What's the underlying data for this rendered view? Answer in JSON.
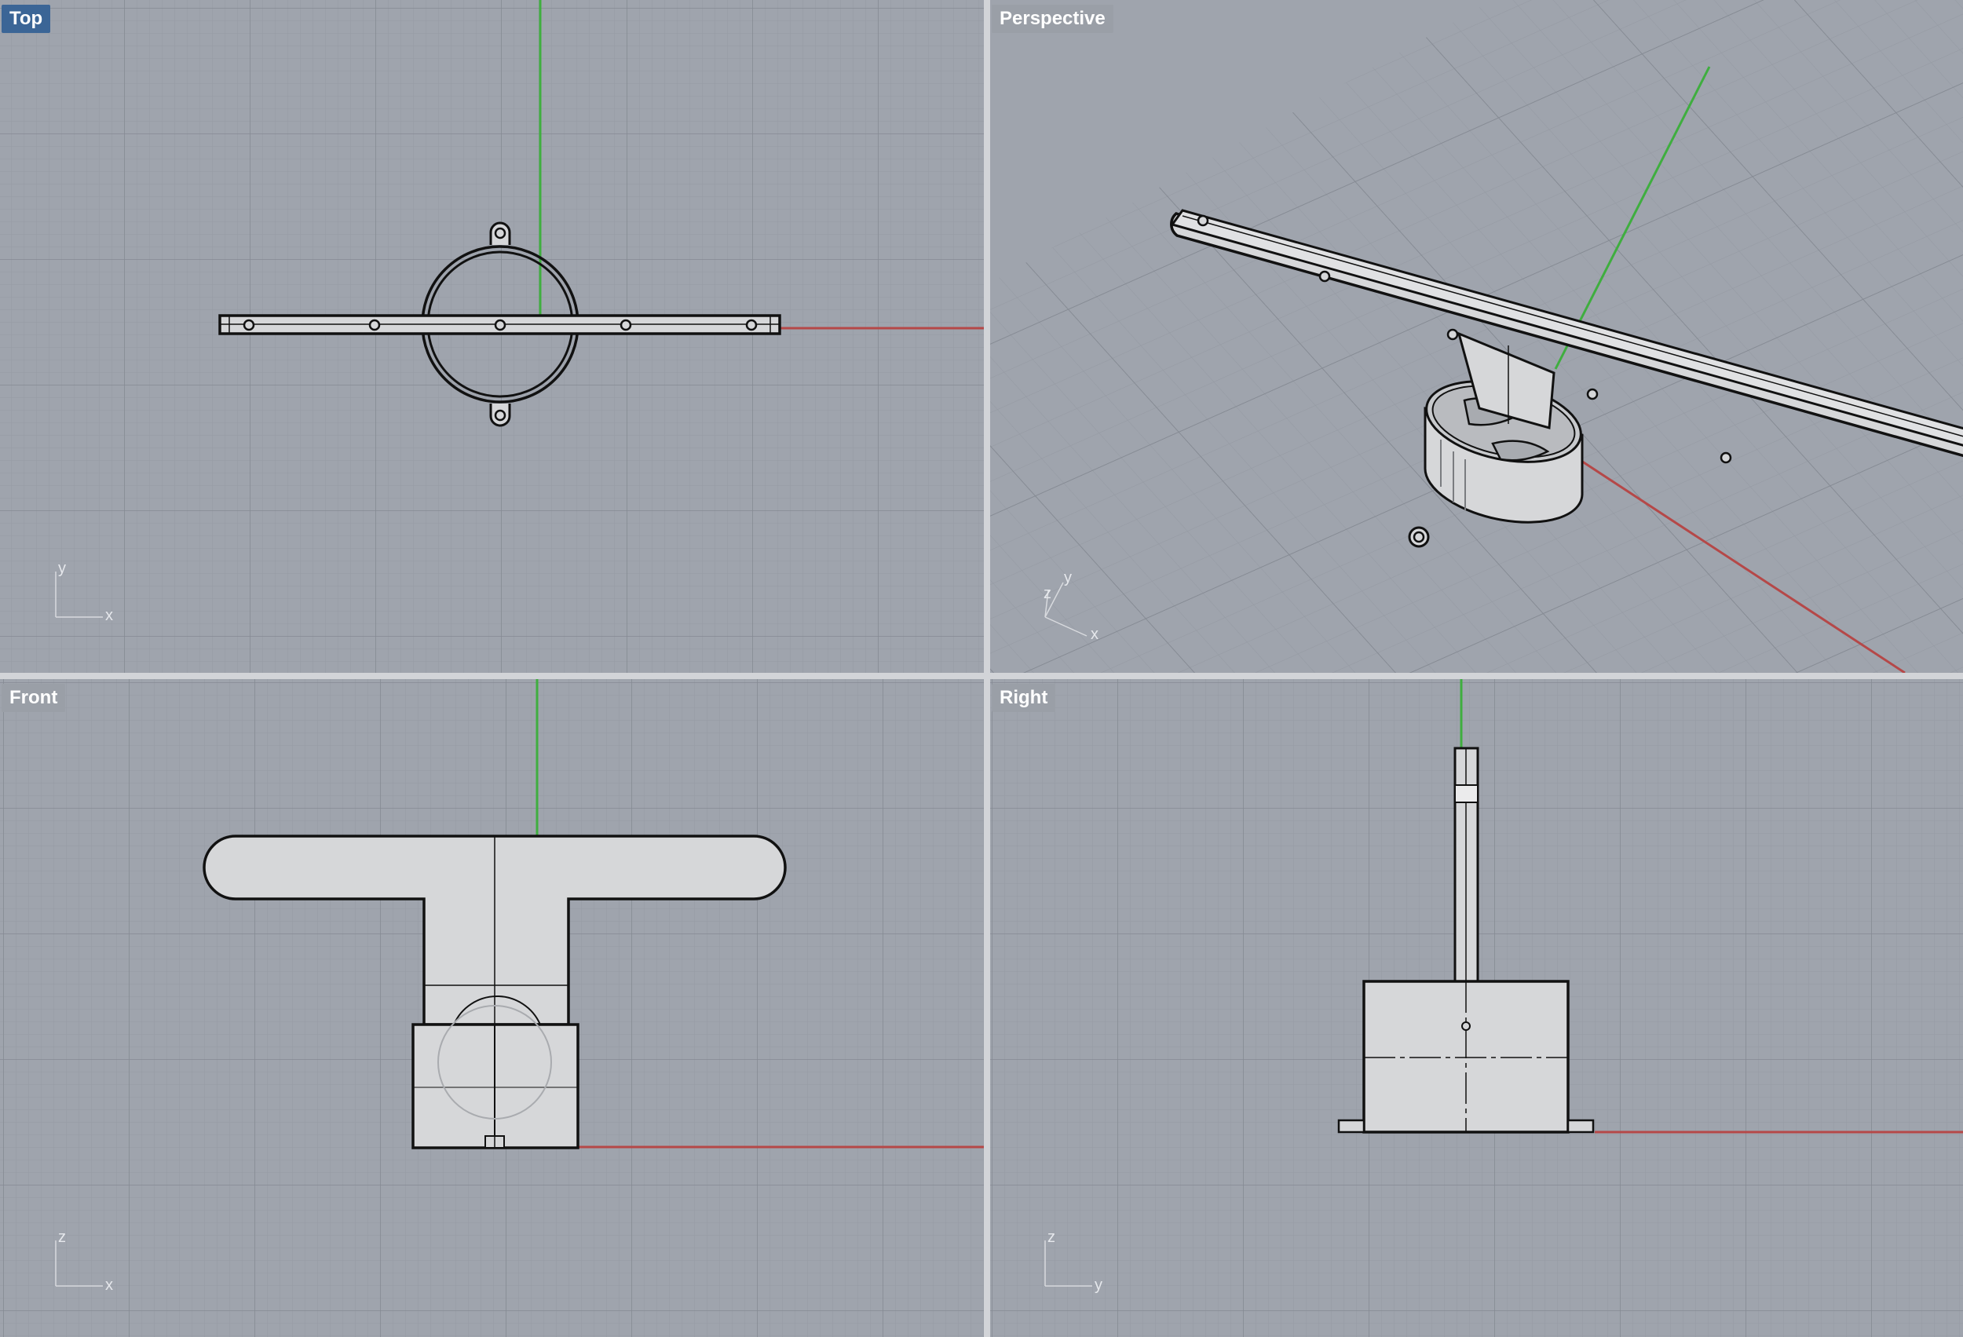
{
  "viewports": {
    "top": {
      "label": "Top",
      "active": true,
      "axis_h": "x",
      "axis_v": "y"
    },
    "perspective": {
      "label": "Perspective",
      "active": false,
      "axis_h": "x",
      "axis_v": "y",
      "axis_z": "z"
    },
    "front": {
      "label": "Front",
      "active": false,
      "axis_h": "x",
      "axis_v": "z"
    },
    "right": {
      "label": "Right",
      "active": false,
      "axis_h": "y",
      "axis_v": "z"
    }
  },
  "colors": {
    "viewport_bg": "#9fa4ad",
    "grid_minor": "#959aa3",
    "grid_major": "#858a93",
    "axis_x": "#b54848",
    "axis_y": "#3fae3f",
    "model_fill": "#d6d7d9",
    "model_edge": "#111111",
    "active_label_bg": "#3b6596"
  }
}
